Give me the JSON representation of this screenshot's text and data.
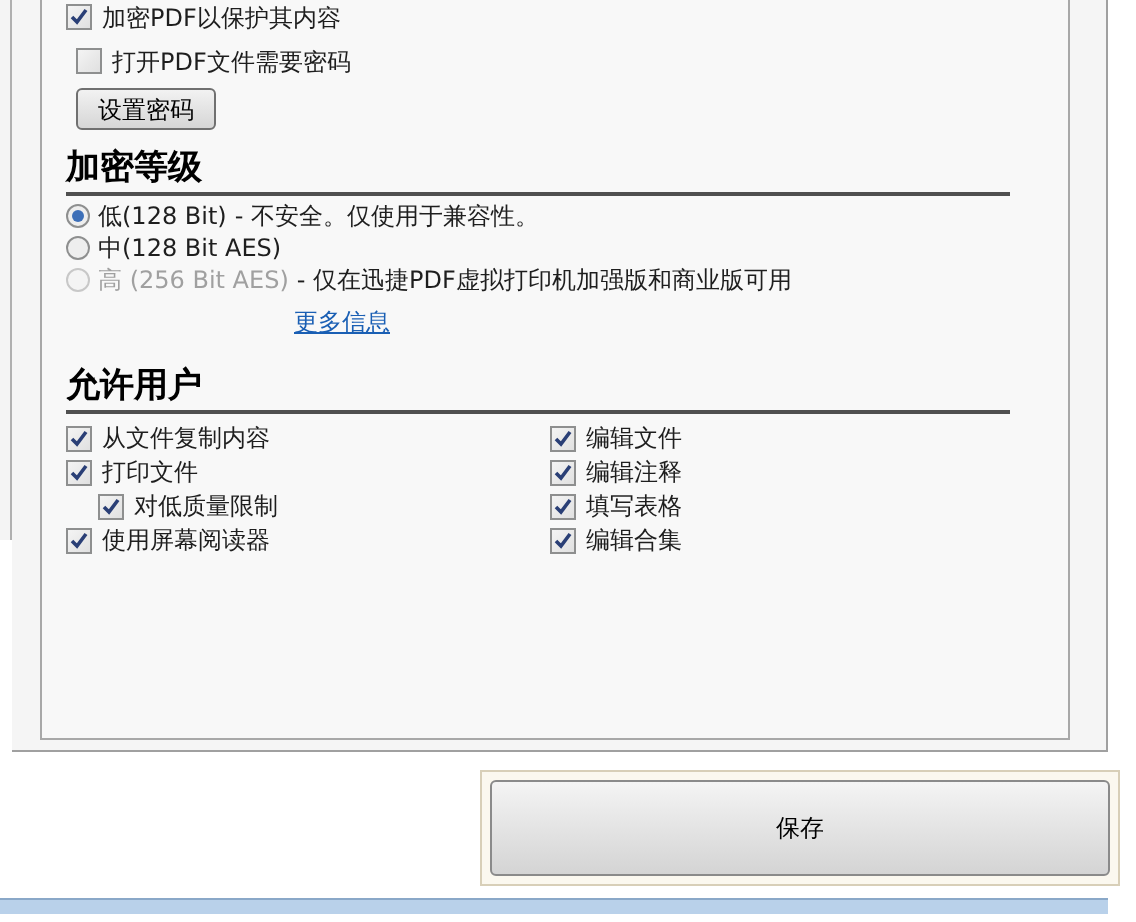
{
  "encrypt": {
    "label": "加密PDF以保护其内容",
    "checked": true
  },
  "require_password": {
    "label": "打开PDF文件需要密码",
    "checked": false
  },
  "set_password_button": "设置密码",
  "encryption_level": {
    "heading": "加密等级",
    "options": [
      {
        "label": "低(128 Bit)",
        "note": "- 不安全。仅使用于兼容性。",
        "selected": true,
        "disabled": false
      },
      {
        "label": "中(128 Bit AES)",
        "selected": false,
        "disabled": false
      },
      {
        "label": "高 (256 Bit AES)",
        "note": "- 仅在迅捷PDF虚拟打印机加强版和商业版可用",
        "link": "更多信息",
        "selected": false,
        "disabled": true
      }
    ]
  },
  "permissions": {
    "heading": "允许用户",
    "columns": [
      [
        {
          "label": "从文件复制内容",
          "checked": true
        },
        {
          "label": "打印文件",
          "checked": true,
          "children": [
            {
              "label": "对低质量限制",
              "checked": true
            }
          ]
        },
        {
          "label": "使用屏幕阅读器",
          "checked": true
        }
      ],
      [
        {
          "label": "编辑文件",
          "checked": true
        },
        {
          "label": "编辑注释",
          "checked": true
        },
        {
          "label": "填写表格",
          "checked": true
        },
        {
          "label": "编辑合集",
          "checked": true
        }
      ]
    ]
  },
  "save_button": "保存"
}
